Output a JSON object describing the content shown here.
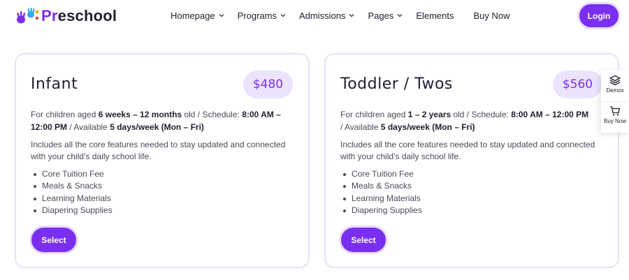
{
  "header": {
    "logo_text_accent": "Pr",
    "logo_text_rest": "eschool",
    "nav": [
      {
        "label": "Homepage",
        "has_dropdown": true
      },
      {
        "label": "Programs",
        "has_dropdown": true
      },
      {
        "label": "Admissions",
        "has_dropdown": true
      },
      {
        "label": "Pages",
        "has_dropdown": true
      },
      {
        "label": "Elements",
        "has_dropdown": false
      },
      {
        "label": "Buy Now",
        "has_dropdown": false
      }
    ],
    "login_label": "Login"
  },
  "cards": [
    {
      "title": "Infant",
      "price": "$480",
      "desc_prefix": "For children aged ",
      "age": "6 weeks – 12 months",
      "desc_mid": " old / Schedule: ",
      "schedule": "8:00 AM – 12:00 PM",
      "desc_mid2": " / Available ",
      "availability": "5 days/week (Mon – Fri)",
      "includes": "Includes all the core features needed to stay updated and connected with your child’s daily school life.",
      "features": [
        "Core Tuition Fee",
        "Meals & Snacks",
        "Learning Materials",
        "Diapering Supplies"
      ],
      "button": "Select"
    },
    {
      "title": "Toddler / Twos",
      "price": "$560",
      "desc_prefix": "For children aged ",
      "age": "1 – 2 years",
      "desc_mid": " old / Schedule: ",
      "schedule": "8:00 AM – 12:00 PM",
      "desc_mid2": " / Available ",
      "availability": "5 days/week (Mon – Fri)",
      "includes": "Includes all the core features needed to stay updated and connected with your child’s daily school life.",
      "features": [
        "Core Tuition Fee",
        "Meals & Snacks",
        "Learning Materials",
        "Diapering Supplies"
      ],
      "button": "Select"
    }
  ],
  "side_panel": {
    "demos_label": "Demos",
    "buy_label": "Buy Now"
  },
  "colors": {
    "accent": "#7a2ff0",
    "accent_light": "#ece3ff",
    "card_border": "#e6e3f7"
  }
}
